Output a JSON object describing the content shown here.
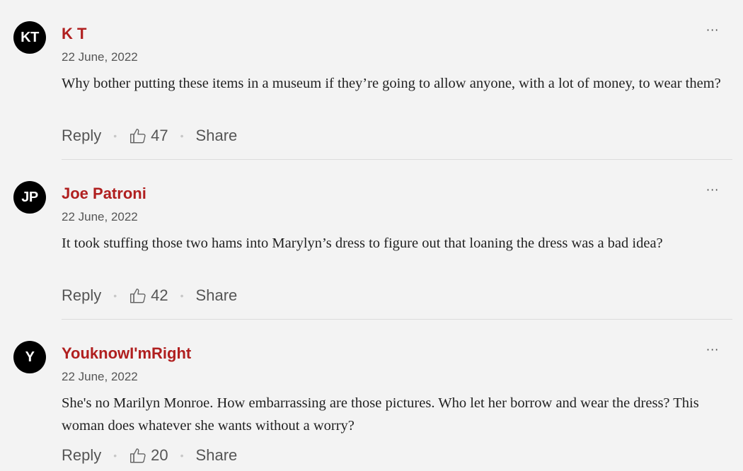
{
  "comments": [
    {
      "initials": "KT",
      "author": "K T",
      "date": "22 June, 2022",
      "text": "Why bother putting these items in a museum if they’re going to allow anyone, with a lot of money, to wear them?",
      "reply_label": "Reply",
      "likes": "47",
      "share_label": "Share",
      "more_label": "···"
    },
    {
      "initials": "JP",
      "author": "Joe Patroni",
      "date": "22 June, 2022",
      "text": "It took stuffing those two hams into Marylyn’s dress to figure out that loaning the dress was a bad idea?",
      "reply_label": "Reply",
      "likes": "42",
      "share_label": "Share",
      "more_label": "···"
    },
    {
      "initials": "Y",
      "author": "YouknowI'mRight",
      "date": "22 June, 2022",
      "text": "She's no Marilyn Monroe. How embarrassing are those pictures. Who let her borrow and wear the dress? This woman does whatever she wants without a worry?",
      "reply_label": "Reply",
      "likes": "20",
      "share_label": "Share",
      "more_label": "···"
    }
  ],
  "icons": {
    "avatar": "user-avatar",
    "like": "thumbs-up-icon",
    "more": "more-options-icon"
  },
  "colors": {
    "background": "#f3f3f3",
    "author_name": "#b01f1f",
    "avatar_bg": "#000000",
    "divider": "#dcdcdc"
  }
}
